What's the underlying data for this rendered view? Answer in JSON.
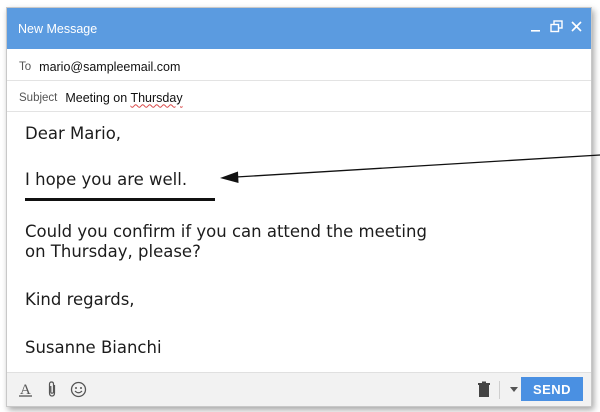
{
  "window": {
    "title": "New Message"
  },
  "fields": {
    "to_label": "To",
    "to_value": "mario@sampleemail.com",
    "subject_label": "Subject",
    "subject_prefix": "Meeting on ",
    "subject_misspelled": "Thursday"
  },
  "message": {
    "greeting": "Dear Mario,",
    "line1": "I hope you are well.",
    "line2": "Could you confirm if you can attend the meeting",
    "line3": "on Thursday, please?",
    "closing": "Kind regards,",
    "signature": "Susanne Bianchi"
  },
  "footer": {
    "send_label": "SEND"
  },
  "icons": {
    "minimize": "minimize-icon",
    "popout": "popout-icon",
    "close": "close-icon",
    "format": "text-format-icon",
    "attach": "paperclip-icon",
    "emoji": "emoji-icon",
    "trash": "trash-icon",
    "more": "dropdown-arrow-icon"
  },
  "colors": {
    "titlebar": "#5b9be0",
    "send_button": "#4a90e2"
  }
}
